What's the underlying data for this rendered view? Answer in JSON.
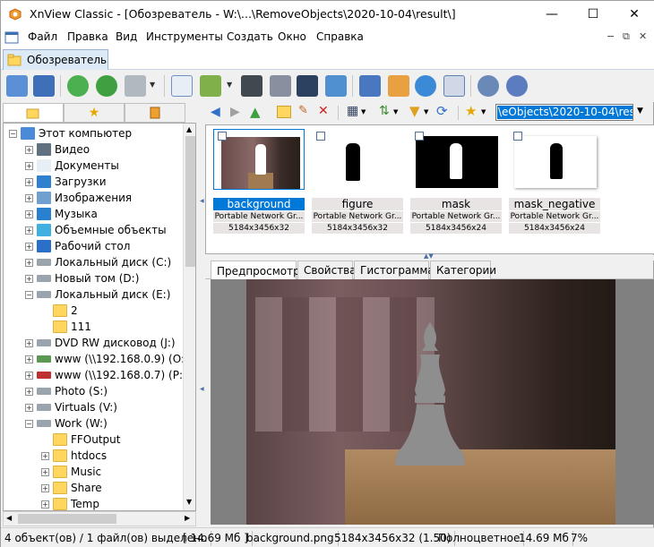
{
  "window": {
    "title": "XnView Classic - [Обозреватель - W:\\...\\RemoveObjects\\2020-10-04\\result\\]",
    "minimize": "—",
    "maximize": "☐",
    "close": "✕"
  },
  "menu": {
    "items": [
      "Файл",
      "Правка",
      "Вид",
      "Инструменты",
      "Создать",
      "Окно",
      "Справка"
    ],
    "mdi_minimize": "−",
    "mdi_restore": "⧉",
    "mdi_close": "✕"
  },
  "tabs": {
    "browser": "Обозреватель"
  },
  "path": {
    "value": "W:\\...\\RemoveObjects\\2020-10-04\\result\\",
    "visible": "eObjects\\2020-10-04\\result\\"
  },
  "tree": {
    "items": [
      {
        "label": "Этот компьютер",
        "icon": "computer-icon",
        "expander": "−"
      },
      {
        "label": "Видео",
        "icon": "video-folder-icon",
        "expander": "+"
      },
      {
        "label": "Документы",
        "icon": "documents-folder-icon",
        "expander": "+"
      },
      {
        "label": "Загрузки",
        "icon": "downloads-folder-icon",
        "expander": "+"
      },
      {
        "label": "Изображения",
        "icon": "pictures-folder-icon",
        "expander": "+"
      },
      {
        "label": "Музыка",
        "icon": "music-folder-icon",
        "expander": "+"
      },
      {
        "label": "Объемные объекты",
        "icon": "3d-objects-folder-icon",
        "expander": "+"
      },
      {
        "label": "Рабочий стол",
        "icon": "desktop-folder-icon",
        "expander": "+"
      },
      {
        "label": "Локальный диск (C:)",
        "icon": "drive-icon",
        "expander": "+"
      },
      {
        "label": "Новый том (D:)",
        "icon": "drive-icon",
        "expander": "+"
      },
      {
        "label": "Локальный диск (E:)",
        "icon": "drive-icon",
        "expander": "−"
      },
      {
        "label": "2",
        "icon": "folder-icon",
        "expander": ""
      },
      {
        "label": "111",
        "icon": "folder-icon",
        "expander": ""
      },
      {
        "label": "DVD RW дисковод (J:)",
        "icon": "dvd-drive-icon",
        "expander": "+"
      },
      {
        "label": "www (\\\\192.168.0.9) (O:)",
        "icon": "network-drive-icon",
        "expander": "+"
      },
      {
        "label": "www (\\\\192.168.0.7) (P:)",
        "icon": "network-drive-disconnected-icon",
        "expander": "+"
      },
      {
        "label": "Photo (S:)",
        "icon": "drive-icon",
        "expander": "+"
      },
      {
        "label": "Virtuals (V:)",
        "icon": "drive-icon",
        "expander": "+"
      },
      {
        "label": "Work (W:)",
        "icon": "drive-icon",
        "expander": "−"
      },
      {
        "label": "FFOutput",
        "icon": "folder-icon",
        "expander": ""
      },
      {
        "label": "htdocs",
        "icon": "folder-icon",
        "expander": "+"
      },
      {
        "label": "Music",
        "icon": "folder-icon",
        "expander": "+"
      },
      {
        "label": "Share",
        "icon": "folder-icon",
        "expander": "+"
      },
      {
        "label": "Temp",
        "icon": "folder-icon",
        "expander": "+"
      }
    ]
  },
  "thumbnails": [
    {
      "name": "background",
      "type": "Portable Network Gr...",
      "dims": "5184x3456x32",
      "selected": true
    },
    {
      "name": "figure",
      "type": "Portable Network Gr...",
      "dims": "5184x3456x32",
      "selected": false
    },
    {
      "name": "mask",
      "type": "Portable Network Gr...",
      "dims": "5184x3456x24",
      "selected": false
    },
    {
      "name": "mask_negative",
      "type": "Portable Network Gr...",
      "dims": "5184x3456x24",
      "selected": false
    }
  ],
  "preview_tabs": [
    "Предпросмотр",
    "Свойства",
    "Гистограмма",
    "Категории"
  ],
  "status": {
    "selection": "4 объект(ов) / 1 файл(ов) выделено",
    "size": "[ 14.69 Мб ]",
    "filename": "background.png",
    "dims": "5184x3456x32 (1.50)",
    "mode": "Полноцветное",
    "filesize": "14.69 Мб",
    "zoom": "7%"
  }
}
